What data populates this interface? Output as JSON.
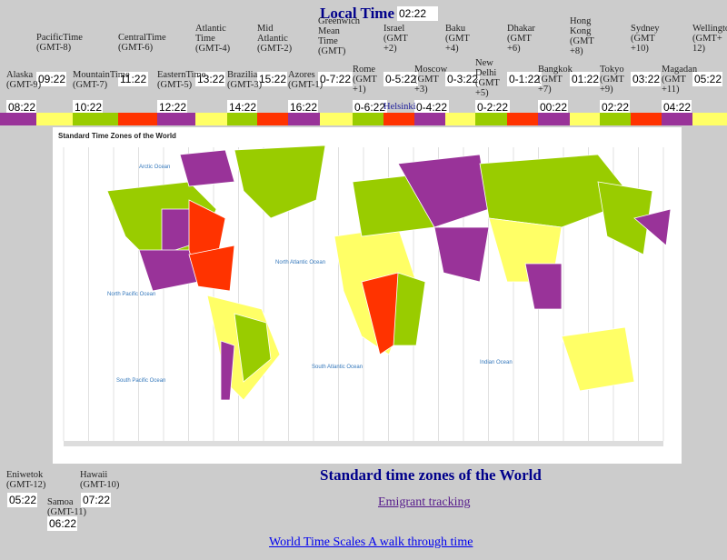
{
  "header": {
    "title": "Local Time",
    "local_time": "02:22"
  },
  "zones_top": [
    {
      "label": [
        "PacificTime",
        "(GMT-8)"
      ],
      "time": "09:22"
    },
    {
      "label": [
        "CentralTime",
        "(GMT-6)"
      ],
      "time": "11:22"
    },
    {
      "label": [
        "Atlantic",
        "Time",
        "(GMT-4)"
      ],
      "time": "13:22"
    },
    {
      "label": [
        "Mid",
        "Atlantic",
        "(GMT-2)"
      ],
      "time": "15:22"
    },
    {
      "label": [
        "Greenwich",
        "Mean",
        "Time",
        "(GMT)"
      ],
      "time": "0-7:22"
    },
    {
      "label": [
        "Israel",
        "(GMT",
        "+2)"
      ],
      "time": "0-5:22"
    },
    {
      "label": [
        "Baku",
        "(GMT",
        "+4)"
      ],
      "time": "0-3:22"
    },
    {
      "label": [
        "Dhakar",
        "(GMT",
        "+6)"
      ],
      "time": "0-1:22"
    },
    {
      "label": [
        "Hong",
        "Kong",
        "(GMT",
        "+8)"
      ],
      "time": "01:22"
    },
    {
      "label": [
        "Sydney",
        "(GMT",
        "+10)"
      ],
      "time": "03:22"
    },
    {
      "label": [
        "Wellington",
        "(GMT+",
        "12)"
      ],
      "time": "05:22"
    }
  ],
  "zones_mid": [
    {
      "label": [
        "Alaska",
        "(GMT-9)"
      ],
      "time": "08:22"
    },
    {
      "label": [
        "MountainTime",
        "(GMT-7)"
      ],
      "time": "10:22"
    },
    {
      "label": [
        "EasternTime",
        "(GMT-5)"
      ],
      "time": "12:22"
    },
    {
      "label": [
        "Brazilia",
        "(GMT-3)"
      ],
      "time": "14:22"
    },
    {
      "label": [
        "Azores",
        "(GMT-1)"
      ],
      "time": "16:22"
    },
    {
      "label": [
        "Rome",
        "(GMT",
        "+1)"
      ],
      "time": "0-6:22"
    },
    {
      "label": [
        "Moscow",
        "(GMT",
        "+3)"
      ],
      "time": "0-4:22"
    },
    {
      "label": [
        "New",
        "Delhi",
        "(GMT",
        "+5)"
      ],
      "time": "0-2:22"
    },
    {
      "label": [
        "Bangkok",
        "(GMT",
        "+7)"
      ],
      "time": "00:22"
    },
    {
      "label": [
        "Tokyo",
        "(GMT",
        "+9)"
      ],
      "time": "02:22"
    },
    {
      "label": [
        "Magadan",
        "(GMT",
        "+11)"
      ],
      "time": "04:22"
    }
  ],
  "helsinki_link": "Helsinki",
  "zones_bottom": [
    {
      "label": [
        "Eniwetok",
        "(GMT-12)"
      ],
      "time": "05:22"
    },
    {
      "label": [
        "Samoa",
        "(GMT-11)"
      ],
      "time": "06:22"
    },
    {
      "label": [
        "Hawaii",
        "(GMT-10)"
      ],
      "time": "07:22"
    }
  ],
  "colors": {
    "purple": "#993399",
    "yellow": "#ffff66",
    "green": "#99cc00",
    "red": "#ff3300",
    "title": "#00008b"
  },
  "color_bar": [
    "purple",
    "yellow",
    "green",
    "red",
    "purple",
    "yellow",
    "green",
    "red",
    "purple",
    "yellow",
    "green",
    "red",
    "purple",
    "yellow",
    "green",
    "red",
    "purple",
    "yellow",
    "green",
    "red",
    "purple",
    "yellow"
  ],
  "map": {
    "title": "Standard Time Zones of the World",
    "oceans": [
      "Arctic Ocean",
      "North Atlantic Ocean",
      "North Pacific Ocean",
      "South Pacific Ocean",
      "South Atlantic Ocean",
      "Indian Ocean"
    ]
  },
  "caption": "Standard time zones of the World",
  "links": {
    "emigrant": "Emigrant tracking",
    "world_time_scales": "World Time Scales A walk through time"
  }
}
